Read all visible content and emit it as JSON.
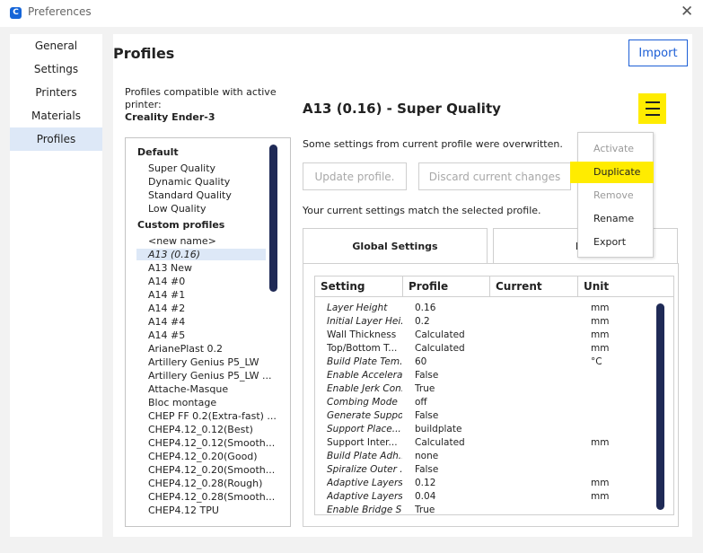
{
  "window": {
    "title": "Preferences",
    "app_icon": "C"
  },
  "sidebar": {
    "items": [
      "General",
      "Settings",
      "Printers",
      "Materials",
      "Profiles"
    ],
    "active": "Profiles"
  },
  "header": {
    "title": "Profiles",
    "import_label": "Import"
  },
  "compat": {
    "line1": "Profiles compatible with active",
    "line2": "printer:",
    "printer": "Creality Ender-3"
  },
  "profile_list": {
    "default_header": "Default",
    "default_items": [
      "Super Quality",
      "Dynamic Quality",
      "Standard Quality",
      "Low Quality"
    ],
    "custom_header": "Custom profiles",
    "custom_items": [
      "<new name>",
      "A13 (0.16)",
      "A13 New",
      "A14 #0",
      "A14 #1",
      "A14 #2",
      "A14 #4",
      "A14 #5",
      "ArianePlast 0.2",
      "Artillery Genius P5_LW",
      "Artillery Genius P5_LW ...",
      "Attache-Masque",
      "Bloc montage",
      "CHEP FF 0.2(Extra-fast) ...",
      "CHEP4.12_0.12(Best)",
      "CHEP4.12_0.12(Smooth...",
      "CHEP4.12_0.20(Good)",
      "CHEP4.12_0.20(Smooth...",
      "CHEP4.12_0.28(Rough)",
      "CHEP4.12_0.28(Smooth...",
      "CHEP4.12 TPU"
    ],
    "selected": "A13 (0.16)"
  },
  "detail": {
    "title": "A13 (0.16) - Super Quality",
    "overwritten_msg": "Some settings from current profile were overwritten.",
    "update_label": "Update profile.",
    "discard_label": "Discard current changes",
    "match_msg": "Your current settings match the selected profile.",
    "tab_global": "Global Settings",
    "tab_extruder": "Extr"
  },
  "table": {
    "headers": [
      "Setting",
      "Profile",
      "Current",
      "Unit"
    ],
    "rows": [
      {
        "setting": "Layer Height",
        "profile": "0.16",
        "unit": "mm",
        "italic": true
      },
      {
        "setting": "Initial Layer Hei...",
        "profile": "0.2",
        "unit": "mm",
        "italic": true
      },
      {
        "setting": "Wall Thickness",
        "profile": "Calculated",
        "unit": "mm",
        "italic": false
      },
      {
        "setting": "Top/Bottom T...",
        "profile": "Calculated",
        "unit": "mm",
        "italic": false
      },
      {
        "setting": "Build Plate Tem...",
        "profile": "60",
        "unit": "°C",
        "italic": true
      },
      {
        "setting": "Enable Accelera...",
        "profile": "False",
        "unit": "",
        "italic": true
      },
      {
        "setting": "Enable Jerk Con...",
        "profile": "True",
        "unit": "",
        "italic": true
      },
      {
        "setting": "Combing Mode",
        "profile": "off",
        "unit": "",
        "italic": true
      },
      {
        "setting": "Generate Support",
        "profile": "False",
        "unit": "",
        "italic": true
      },
      {
        "setting": "Support Place...",
        "profile": "buildplate",
        "unit": "",
        "italic": true
      },
      {
        "setting": "Support Inter...",
        "profile": "Calculated",
        "unit": "mm",
        "italic": false
      },
      {
        "setting": "Build Plate Adh...",
        "profile": "none",
        "unit": "",
        "italic": true
      },
      {
        "setting": "Spiralize Outer ...",
        "profile": "False",
        "unit": "",
        "italic": true
      },
      {
        "setting": "Adaptive Layers...",
        "profile": "0.12",
        "unit": "mm",
        "italic": true
      },
      {
        "setting": "Adaptive Layers...",
        "profile": "0.04",
        "unit": "mm",
        "italic": true
      },
      {
        "setting": "Enable Bridge S...",
        "profile": "True",
        "unit": "",
        "italic": true
      }
    ]
  },
  "context_menu": {
    "items": [
      {
        "label": "Activate",
        "enabled": false,
        "highlighted": false
      },
      {
        "label": "Duplicate",
        "enabled": true,
        "highlighted": true
      },
      {
        "label": "Remove",
        "enabled": false,
        "highlighted": false
      },
      {
        "label": "Rename",
        "enabled": true,
        "highlighted": false
      },
      {
        "label": "Export",
        "enabled": true,
        "highlighted": false
      }
    ]
  },
  "colors": {
    "accent": "#1d5fd6",
    "highlight": "#ffec00",
    "scrollbar": "#1f2a56",
    "selection": "#dde8f7"
  }
}
